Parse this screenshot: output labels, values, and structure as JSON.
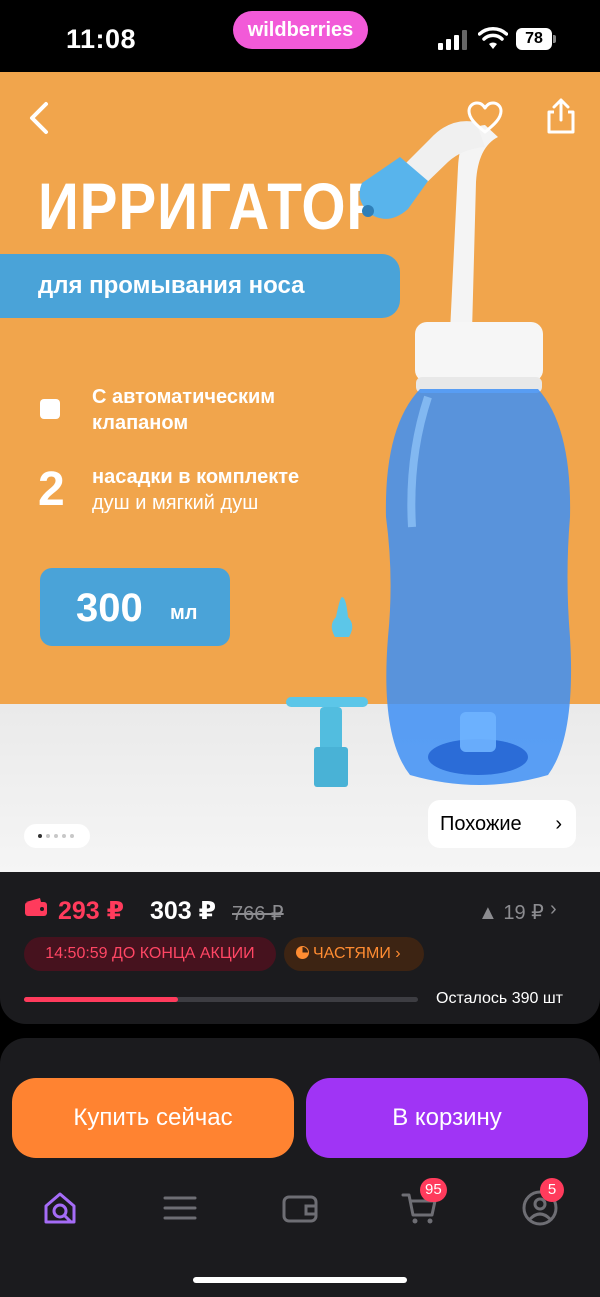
{
  "status_bar": {
    "time": "11:08",
    "app_pill": "wildberries",
    "battery": "78"
  },
  "product_image": {
    "title": "ИРРИГАТОР",
    "banner": "для промывания носа",
    "feature1": "С автоматическим клапаном",
    "feature2_num": "2",
    "feature2_title": "насадки в комплекте",
    "feature2_sub": "душ и мягкий душ",
    "volume_num": "300",
    "volume_unit": "мл",
    "similar_label": "Похожие",
    "carousel_pages": 5,
    "carousel_active": 0
  },
  "price": {
    "wallet_price": "293 ₽",
    "current_price": "303 ₽",
    "old_price": "766 ₽",
    "delta": "▲ 19 ₽",
    "timer": "14:50:59",
    "timer_label": "ДО КОНЦА АКЦИИ",
    "parts_label": "ЧАСТЯМИ",
    "stock_text": "Осталось 390 шт",
    "stock_progress": 0.39
  },
  "actions": {
    "buy_now": "Купить сейчас",
    "add_to_cart": "В корзину"
  },
  "tab_bar": {
    "cart_badge": "95",
    "profile_badge": "5"
  },
  "colors": {
    "accent_purple": "#a034f5",
    "accent_orange": "#ff8331",
    "price_red": "#ff3b5c",
    "wb_pink": "#f25ad8"
  }
}
